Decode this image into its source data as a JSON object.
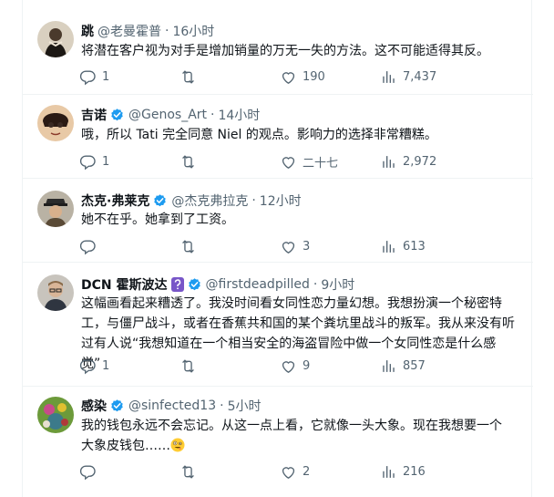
{
  "tweets": [
    {
      "name": "跳",
      "handle": "@老曼霍普",
      "time": "16小时",
      "text": "将潜在客户视为对手是增加销量的万无一失的方法。这不可能适得其反。",
      "replies": "1",
      "retweets": "",
      "likes": "190",
      "views": "7,437"
    },
    {
      "name": "吉诺",
      "handle": "@Genos_Art",
      "time": "14小时",
      "text": "哦，所以 Tati 完全同意 Niel 的观点。影响力的选择非常糟糕。",
      "replies": "1",
      "retweets": "",
      "likes": "二十七",
      "views": "2,972"
    },
    {
      "name": "杰克·弗莱克",
      "handle": "@杰克弗拉克",
      "time": "12小时",
      "text": "她不在乎。她拿到了工资。",
      "replies": "",
      "retweets": "",
      "likes": "3",
      "views": "613"
    },
    {
      "name": "DCN 霍斯波达",
      "handle": "@firstdeadpilled",
      "time": "9小时",
      "text": "这幅画看起来糟透了。我没时间看女同性恋力量幻想。我想扮演一个秘密特工，与僵尸战斗，或者在香蕉共和国的某个粪坑里战斗的叛军。我从来没有听过有人说“我想知道在一个相当安全的海盗冒险中做一个女同性恋是什么感觉”",
      "replies": "1",
      "retweets": "",
      "likes": "9",
      "views": "857"
    },
    {
      "name": "感染",
      "handle": "@sinfected13",
      "time": "5小时",
      "text": "我的钱包永远不会忘记。从这一点上看，它就像一头大象。现在我想要一个大象皮钱包……",
      "replies": "",
      "retweets": "",
      "likes": "2",
      "views": "216"
    }
  ],
  "icons": {
    "reply": "reply-icon",
    "retweet": "retweet-icon",
    "like": "like-icon",
    "views": "views-icon",
    "verified": "verified-icon",
    "emoji": "zany-face-emoji"
  },
  "colors": {
    "verified": "#1d9bf0",
    "secondary_text": "#536471",
    "primary_text": "#0f1419",
    "divider": "#eff3f4"
  }
}
